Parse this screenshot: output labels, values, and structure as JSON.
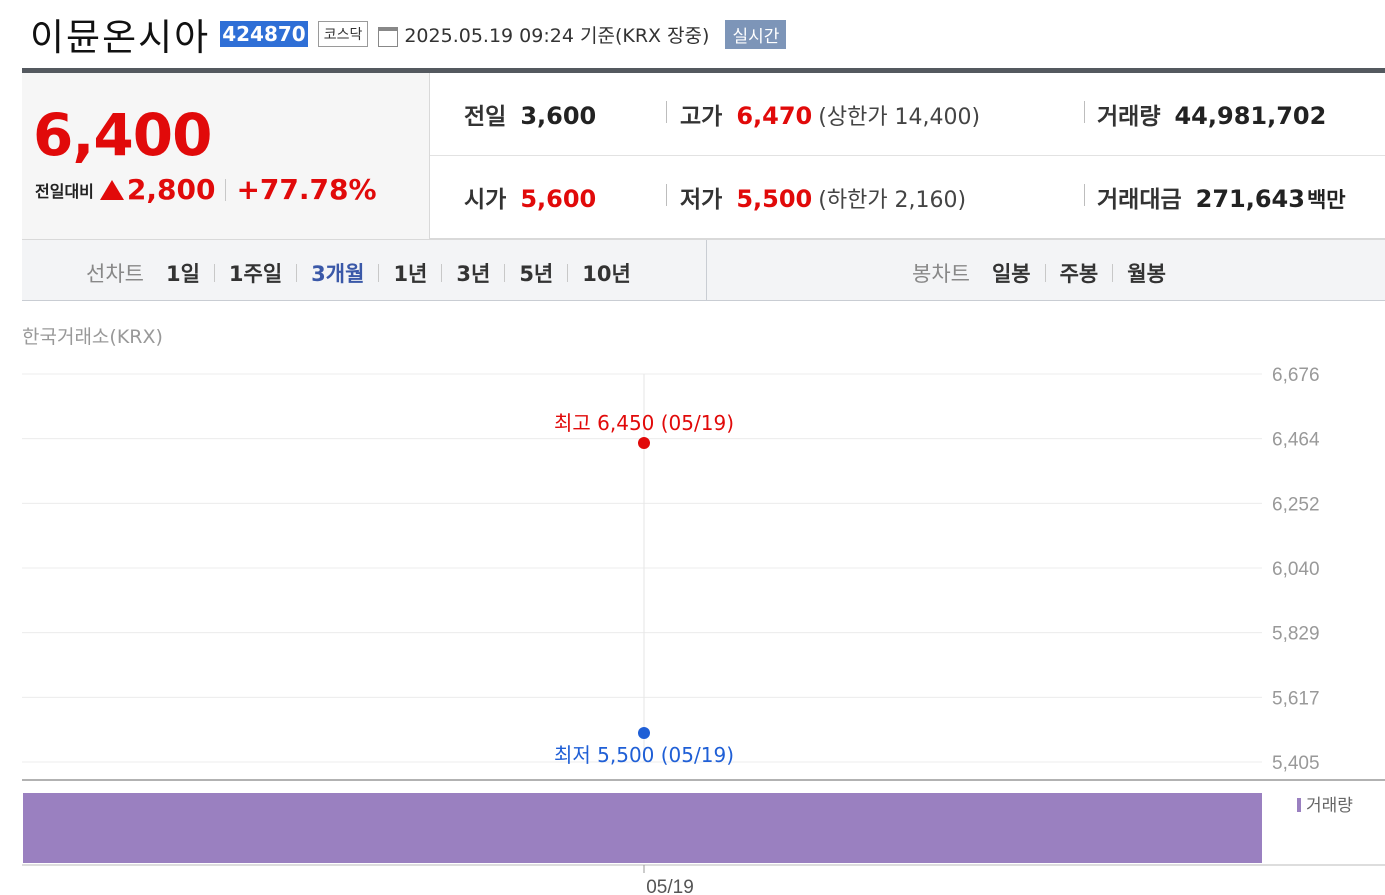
{
  "header": {
    "stock_name": "이뮨온시아",
    "stock_code": "424870",
    "market": "코스닥",
    "datetime": "2025.05.19 09:24",
    "basis": "기준(KRX 장중)",
    "realtime": "실시간"
  },
  "price": {
    "current": "6,400",
    "change_label": "전일대비",
    "change_amount": "2,800",
    "change_percent": "+77.78%"
  },
  "info": {
    "prev_label": "전일",
    "prev_value": "3,600",
    "high_label": "고가",
    "high_value": "6,470",
    "upper_limit": "(상한가 14,400)",
    "volume_label": "거래량",
    "volume_value": "44,981,702",
    "open_label": "시가",
    "open_value": "5,600",
    "low_label": "저가",
    "low_value": "5,500",
    "lower_limit": "(하한가 2,160)",
    "amount_label": "거래대금",
    "amount_value": "271,643",
    "amount_unit": "백만"
  },
  "tabs": {
    "line_chart_title": "선차트",
    "line_items": [
      "1일",
      "1주일",
      "3개월",
      "1년",
      "3년",
      "5년",
      "10년"
    ],
    "active_line_item": "3개월",
    "candle_chart_title": "봉차트",
    "candle_items": [
      "일봉",
      "주봉",
      "월봉"
    ]
  },
  "exchange": "한국거래소(KRX)",
  "colors": {
    "up": "#e10a0a",
    "down": "#1f5fd6",
    "volume": "#9a80c0",
    "active_tab": "#3a58a8"
  },
  "chart_data": {
    "type": "line",
    "x": [
      "05/19"
    ],
    "series": [
      {
        "values": [
          6400
        ]
      }
    ],
    "ylim": [
      5405,
      6676
    ],
    "yticks": [
      "6,676",
      "6,464",
      "6,252",
      "6,040",
      "5,829",
      "5,617",
      "5,405"
    ],
    "xticks": [
      "05/19"
    ],
    "annotations": [
      {
        "text": "최고 6,450 (05/19)",
        "x": "05/19",
        "y": 6450,
        "color": "#e10a0a"
      },
      {
        "text": "최저 5,500 (05/19)",
        "x": "05/19",
        "y": 5500,
        "color": "#1f5fd6"
      }
    ],
    "volume": {
      "label": "거래량",
      "values": [
        44981702
      ]
    }
  }
}
